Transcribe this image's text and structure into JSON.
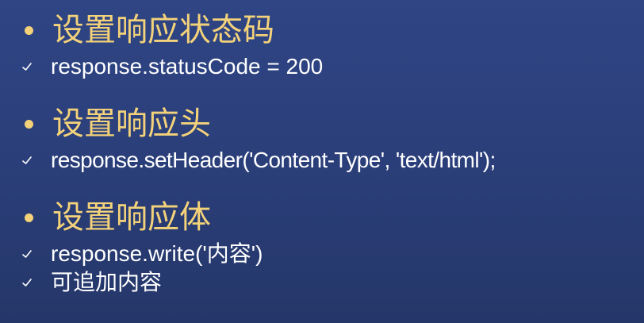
{
  "sections": [
    {
      "heading": "设置响应状态码",
      "lines": [
        "response.statusCode = 200"
      ]
    },
    {
      "heading": "设置响应头",
      "lines": [
        "response.setHeader('Content-Type', 'text/html');"
      ]
    },
    {
      "heading": "设置响应体",
      "lines": [
        "response.write('内容')",
        "可追加内容"
      ]
    }
  ],
  "colors": {
    "background_top": "#2f4584",
    "background_bottom": "#253769",
    "heading": "#f3d27a",
    "text": "#ffffff"
  },
  "icons": {
    "bullet": "bullet-dot-icon",
    "check": "check-icon"
  }
}
